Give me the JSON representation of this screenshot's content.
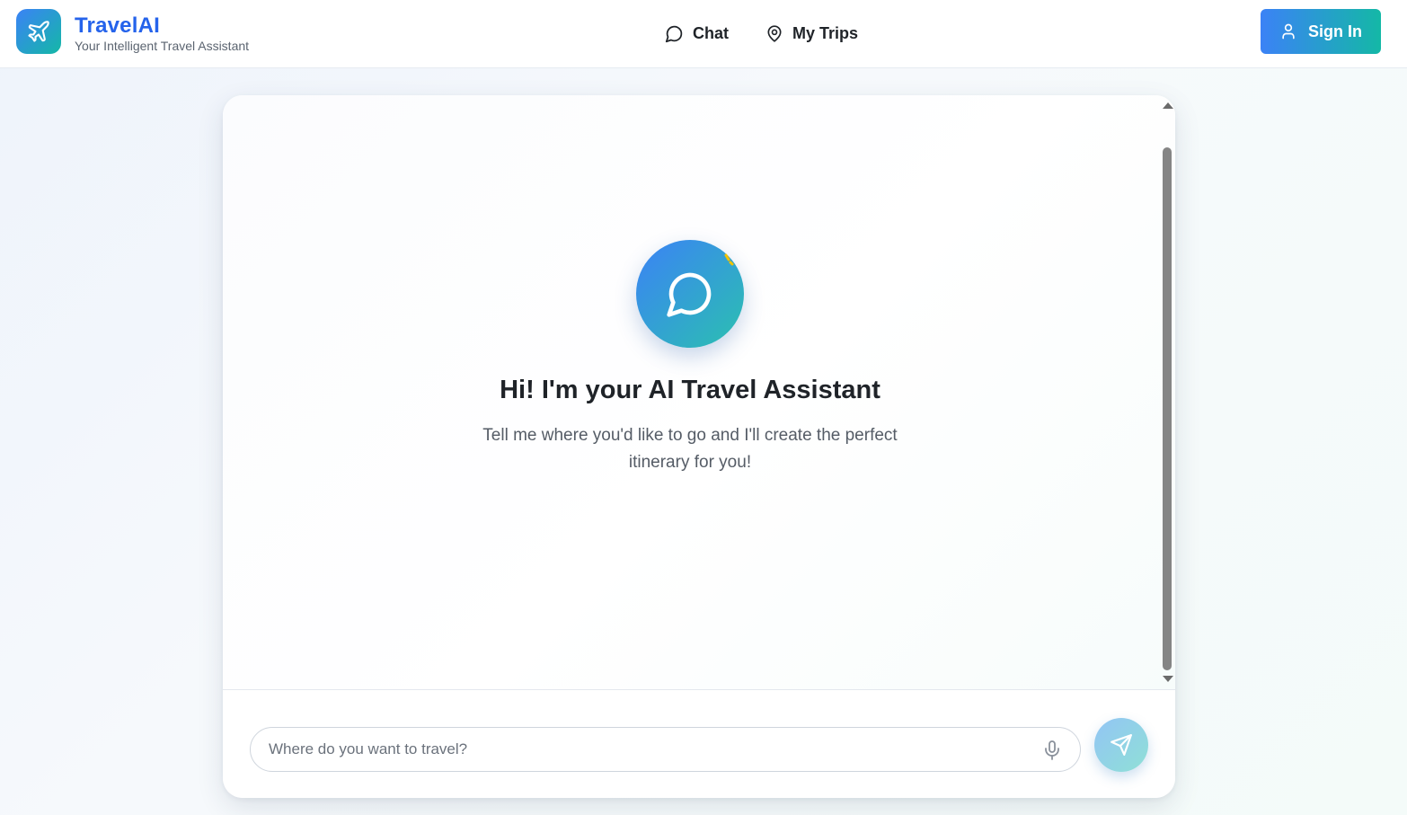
{
  "header": {
    "brand_title": "TravelAI",
    "brand_subtitle": "Your Intelligent Travel Assistant",
    "logo_icon": "airplane-icon",
    "nav": [
      {
        "label": "Chat",
        "icon": "chat-bubble-icon"
      },
      {
        "label": "My Trips",
        "icon": "map-pin-icon"
      }
    ],
    "signin_label": "Sign In",
    "signin_icon": "user-icon"
  },
  "chat": {
    "welcome_title": "Hi! I'm your AI Travel Assistant",
    "welcome_subtitle": "Tell me where you'd like to go and I'll create the perfect itinerary for you!",
    "avatar_icon": "chat-bubble-icon"
  },
  "composer": {
    "placeholder": "Where do you want to travel?",
    "value": "",
    "mic_icon": "microphone-icon",
    "send_icon": "send-icon"
  },
  "colors": {
    "brand_blue": "#3b82f6",
    "brand_teal": "#14b8a6",
    "title_blue": "#2563eb"
  }
}
